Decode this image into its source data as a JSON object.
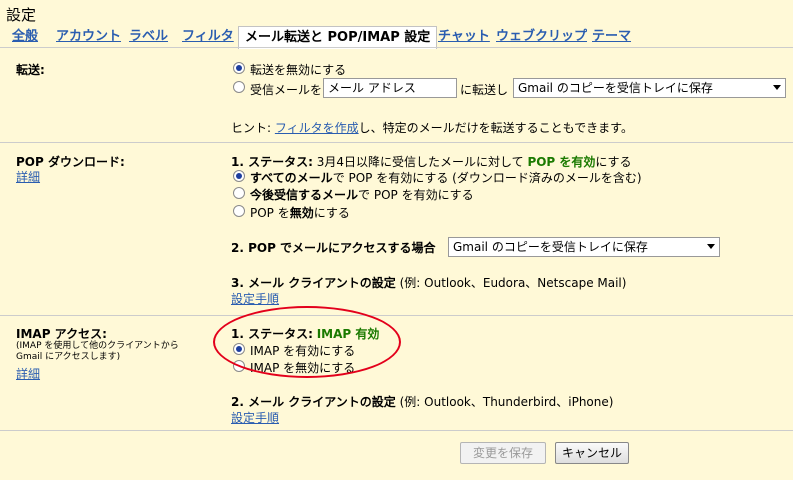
{
  "title": "設定",
  "tabs": [
    {
      "label": "全般"
    },
    {
      "label": "アカウント"
    },
    {
      "label": "ラベル"
    },
    {
      "label": "フィルタ"
    },
    {
      "label": "メール転送と POP/IMAP 設定"
    },
    {
      "label": "チャット"
    },
    {
      "label": "ウェブクリップ"
    },
    {
      "label": "テーマ"
    }
  ],
  "forwarding": {
    "label": "転送:",
    "option_disable": "転送を無効にする",
    "option_forward_prefix": "受信メールを",
    "address_placeholder": "メール アドレス",
    "option_forward_mid": "に転送し",
    "copy_select": "Gmail のコピーを受信トレイに保存",
    "hint_prefix": "ヒント: ",
    "hint_link": "フィルタを作成",
    "hint_suffix": "し、特定のメールだけを転送することもできます。"
  },
  "pop": {
    "label": "POP ダウンロード:",
    "details_link": "詳細",
    "status_prefix": "1. ステータス:",
    "status_text": " 3月4日以降に受信したメールに対して ",
    "status_value": "POP を有効",
    "status_suffix": "にする",
    "opt_all_bold": "すべてのメール",
    "opt_all_rest": "で POP を有効にする (ダウンロード済みのメールを含む)",
    "opt_future_bold": "今後受信するメール",
    "opt_future_rest": "で POP を有効にする",
    "opt_disable_prefix": "POP を",
    "opt_disable_bold": "無効",
    "opt_disable_suffix": "にする",
    "access_label": "2. POP でメールにアクセスする場合",
    "access_select": "Gmail のコピーを受信トレイに保存",
    "client_label": "3. メール クライアントの設定",
    "client_examples": " (例: Outlook、Eudora、Netscape Mail)",
    "setup_link": "設定手順"
  },
  "imap": {
    "label": "IMAP アクセス:",
    "sublabel_line1": "(IMAP を使用して他のクライアントから",
    "sublabel_line2": "Gmail にアクセスします)",
    "details_link": "詳細",
    "status_prefix": "1. ステータス:",
    "status_value": "IMAP 有効",
    "opt_enable": "IMAP を有効にする",
    "opt_disable": "IMAP を無効にする",
    "client_label": "2. メール クライアントの設定",
    "client_examples": " (例: Outlook、Thunderbird、iPhone)",
    "setup_link": "設定手順"
  },
  "buttons": {
    "save": "変更を保存",
    "cancel": "キャンセル"
  },
  "colors": {
    "link": "#2a5db0",
    "status_green": "#1a7a00",
    "highlight_ellipse": "#e3001b",
    "background": "#fff9d7"
  }
}
